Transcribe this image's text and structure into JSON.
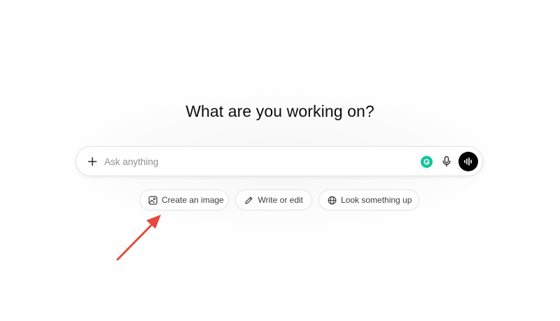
{
  "heading": "What are you working on?",
  "composer": {
    "placeholder": "Ask anything",
    "value": "",
    "plus_icon": "plus-icon",
    "extension_icon": "grammarly-icon",
    "mic_icon": "microphone-icon",
    "voice_icon": "voice-mode-icon"
  },
  "suggestions": [
    {
      "label": "Create an image",
      "icon": "image-icon"
    },
    {
      "label": "Write or edit",
      "icon": "pencil-icon"
    },
    {
      "label": "Look something up",
      "icon": "globe-icon"
    }
  ],
  "annotation": {
    "type": "arrow",
    "color": "#e5483c"
  },
  "colors": {
    "background": "#ffffff",
    "text": "#0d0d0d",
    "chip_border": "#e3e3e3",
    "voice_button": "#000000",
    "grammarly": "#15c39a"
  }
}
